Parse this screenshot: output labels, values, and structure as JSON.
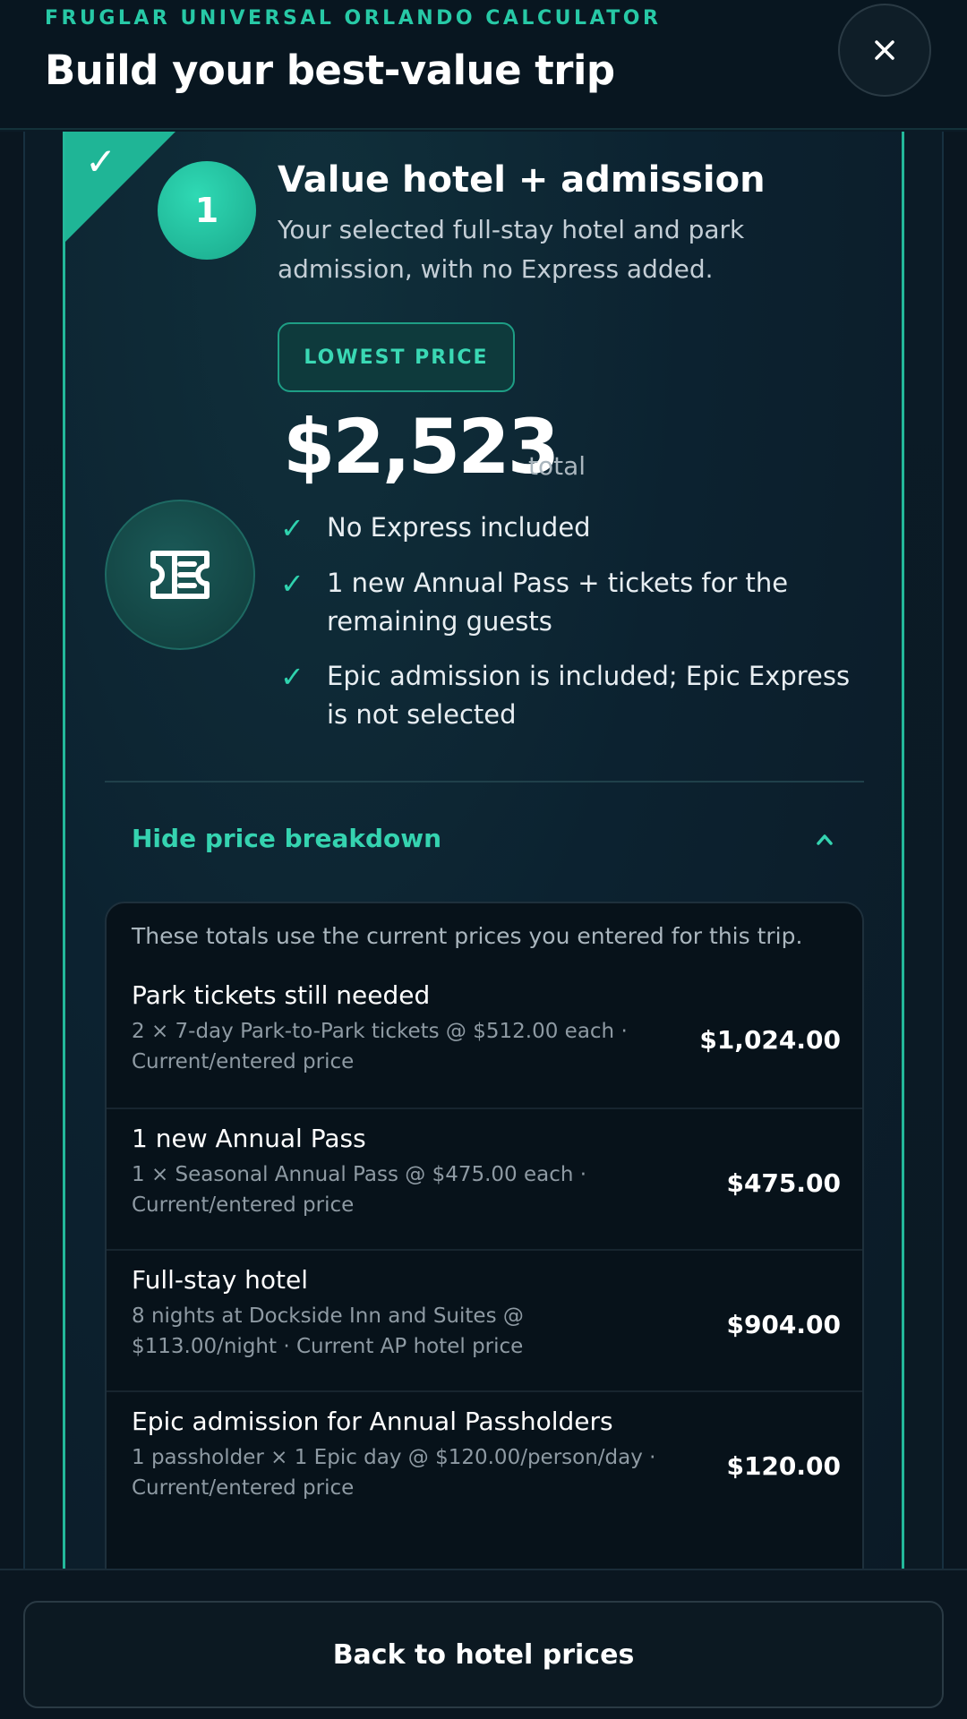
{
  "header": {
    "eyebrow": "FRUGLAR UNIVERSAL ORLANDO CALCULATOR",
    "title": "Build your best-value trip",
    "close_icon": "close-icon"
  },
  "option": {
    "selected": true,
    "number": "1",
    "title": "Value hotel + admission",
    "description": "Your selected full-stay hotel and park admission, with no Express added.",
    "badge": "LOWEST PRICE",
    "price": "$2,523",
    "price_unit": "total",
    "icon": "ticket-icon",
    "features": [
      {
        "text": "No Express included"
      },
      {
        "text": "1 new Annual Pass + tickets for the remaining guests"
      },
      {
        "text": "Epic admission is included; Epic Express is not selected"
      }
    ],
    "toggle_label": "Hide price breakdown"
  },
  "breakdown": {
    "note": "These totals use the current prices you entered for this trip.",
    "items": [
      {
        "label": "Park tickets still needed",
        "detail": "2 × 7-day Park-to-Park tickets @ $512.00 each · Current/entered price",
        "amount": "$1,024.00"
      },
      {
        "label": "1 new Annual Pass",
        "detail": "1 × Seasonal Annual Pass @ $475.00 each · Current/entered price",
        "amount": "$475.00"
      },
      {
        "label": "Full-stay hotel",
        "detail": "8 nights at Dockside Inn and Suites @ $113.00/night · Current AP hotel price",
        "amount": "$904.00"
      },
      {
        "label": "Epic admission for Annual Passholders",
        "detail": "1 passholder × 1 Epic day @ $120.00/person/day · Current/entered price",
        "amount": "$120.00"
      }
    ]
  },
  "footer": {
    "back_label": "Back to hotel prices"
  },
  "colors": {
    "accent": "#27c9a6",
    "background": "#0b1a24",
    "card_border": "#23b89a"
  }
}
